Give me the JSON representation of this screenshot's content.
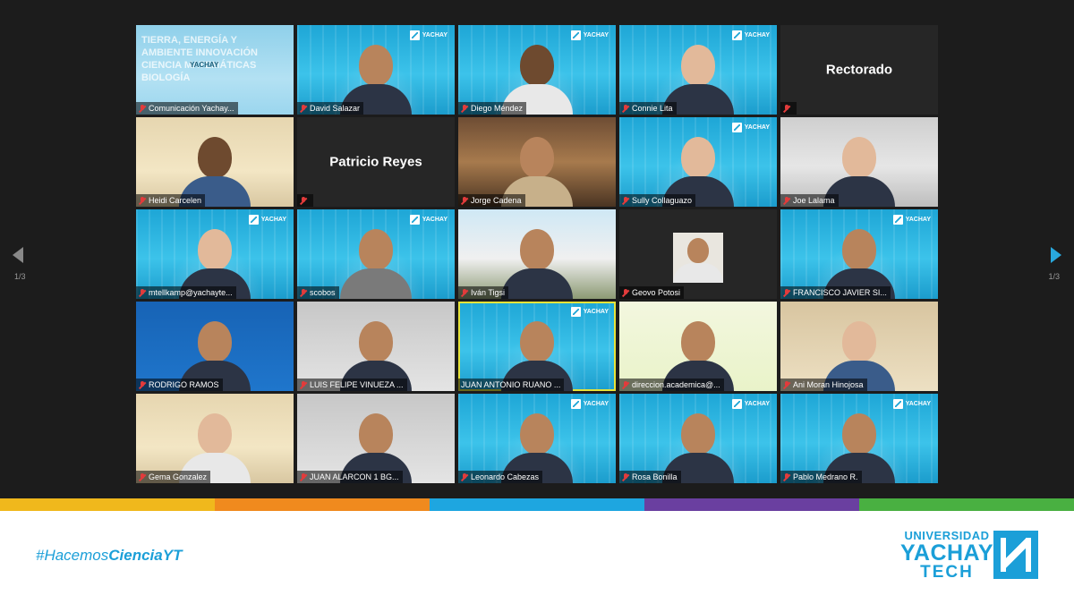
{
  "meeting": {
    "page_left": "1/3",
    "page_right": "1/3",
    "tiles": [
      {
        "name": "Comunicación Yachay...",
        "style": "cover",
        "cover_text": "TIERRA, ENERGÍA Y AMBIENTE INNOVACIÓN CIENCIA MATEMÁTICAS BIOLOGÍA"
      },
      {
        "name": "David Salazar",
        "style": "blue"
      },
      {
        "name": "Diego Méndez",
        "style": "blue"
      },
      {
        "name": "Connie Lita",
        "style": "blue"
      },
      {
        "name": "",
        "style": "dark",
        "display_name": "Rectorado"
      },
      {
        "name": "Heidi Carcelen",
        "style": "warm"
      },
      {
        "name": "",
        "style": "dark",
        "display_name": "Patricio Reyes"
      },
      {
        "name": "Jorge Cadena",
        "style": "wood"
      },
      {
        "name": "Sully Collaguazo",
        "style": "blue"
      },
      {
        "name": "Joe Lalama",
        "style": "office"
      },
      {
        "name": "mtellkamp@yachayte...",
        "style": "blue"
      },
      {
        "name": "scobos",
        "style": "blue"
      },
      {
        "name": "Iván Tigsi",
        "style": "sky"
      },
      {
        "name": "Geovo Potosi",
        "style": "dark"
      },
      {
        "name": "FRANCISCO JAVIER SI...",
        "style": "blue"
      },
      {
        "name": "RODRIGO RAMOS",
        "style": "uniandes"
      },
      {
        "name": "LUIS FELIPE VINUEZA ...",
        "style": "grey"
      },
      {
        "name": "JUAN ANTONIO RUANO ...",
        "style": "blue",
        "active": true
      },
      {
        "name": "direccion.academica@...",
        "style": "green"
      },
      {
        "name": "Ani Moran Hinojosa",
        "style": "beige"
      },
      {
        "name": "Gema Gonzalez",
        "style": "warm"
      },
      {
        "name": "JUAN ALARCON 1 BG...",
        "style": "grey"
      },
      {
        "name": "Leonardo Cabezas",
        "style": "blue"
      },
      {
        "name": "Rosa Bonilla",
        "style": "blue"
      },
      {
        "name": "Pablo Medrano R.",
        "style": "blue"
      }
    ]
  },
  "logo_mini": {
    "line1": "UNIVERSIDAD",
    "line2": "YACHAY",
    "line3": "TECH"
  },
  "color_bar": [
    "#f0b81c",
    "#f08a1e",
    "#1ea6e0",
    "#6a3fa0",
    "#49b041"
  ],
  "footer": {
    "hashtag_prefix": "#Hacemos",
    "hashtag_bold": "CienciaYT",
    "brand_line1": "UNIVERSIDAD",
    "brand_line2": "YACHAY",
    "brand_line3": "TECH"
  }
}
